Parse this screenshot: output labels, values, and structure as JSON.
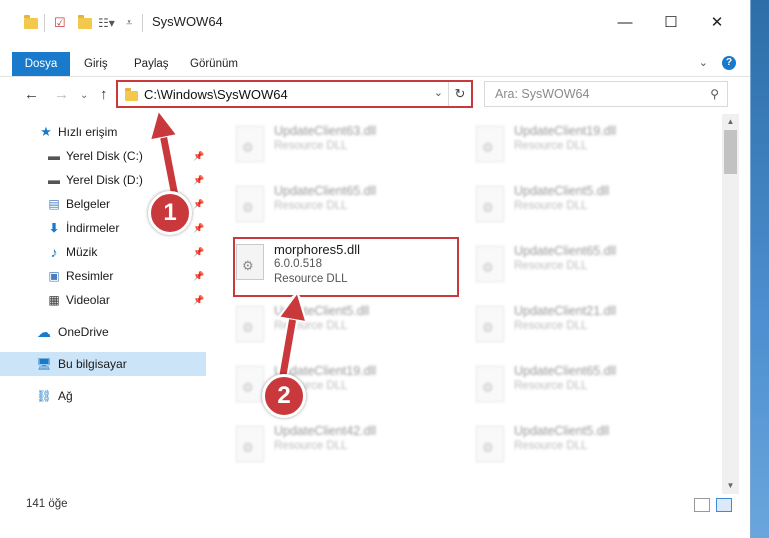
{
  "window": {
    "title": "SysWOW64",
    "controls": {
      "minimize": "—",
      "maximize": "☐",
      "close": "✕"
    }
  },
  "ribbon": {
    "tabs": [
      "Dosya",
      "Giriş",
      "Paylaş",
      "Görünüm"
    ],
    "help": "?"
  },
  "address_bar": {
    "path": "C:\\Windows\\SysWOW64",
    "refresh_icon": "↻"
  },
  "search": {
    "placeholder": "Ara: SysWOW64"
  },
  "sidebar": {
    "quick_access": "Hızlı erişim",
    "items": [
      {
        "label": "Yerel Disk (C:)",
        "icon": "drive-icon"
      },
      {
        "label": "Yerel Disk (D:)",
        "icon": "drive-icon"
      },
      {
        "label": "Belgeler",
        "icon": "documents-icon"
      },
      {
        "label": "İndirmeler",
        "icon": "downloads-icon"
      },
      {
        "label": "Müzik",
        "icon": "music-icon"
      },
      {
        "label": "Resimler",
        "icon": "pictures-icon"
      },
      {
        "label": "Videolar",
        "icon": "videos-icon"
      }
    ],
    "onedrive": "OneDrive",
    "this_pc": "Bu bilgisayar",
    "network": "Ağ"
  },
  "files": {
    "left": [
      {
        "name": "UpdateClient63.dll",
        "type": "Resource DLL"
      },
      {
        "name": "UpdateClient65.dll",
        "type": "Resource DLL"
      },
      {
        "name": "morphores5.dll",
        "version": "6.0.0.518",
        "type": "Resource DLL"
      },
      {
        "name": "UpdateClient5.dll",
        "type": "Resource DLL"
      },
      {
        "name": "UpdateClient19.dll",
        "type": "Resource DLL"
      },
      {
        "name": "UpdateClient42.dll",
        "type": "Resource DLL"
      }
    ],
    "right": [
      {
        "name": "UpdateClient19.dll",
        "type": "Resource DLL"
      },
      {
        "name": "UpdateClient5.dll",
        "type": "Resource DLL"
      },
      {
        "name": "UpdateClient65.dll",
        "type": "Resource DLL"
      },
      {
        "name": "UpdateClient21.dll",
        "type": "Resource DLL"
      },
      {
        "name": "UpdateClient65.dll",
        "type": "Resource DLL"
      },
      {
        "name": "UpdateClient5.dll",
        "type": "Resource DLL"
      }
    ]
  },
  "status": {
    "item_count": "141 öğe"
  },
  "annotations": {
    "badge1": "1",
    "badge2": "2",
    "highlight_color": "#c9393c"
  }
}
